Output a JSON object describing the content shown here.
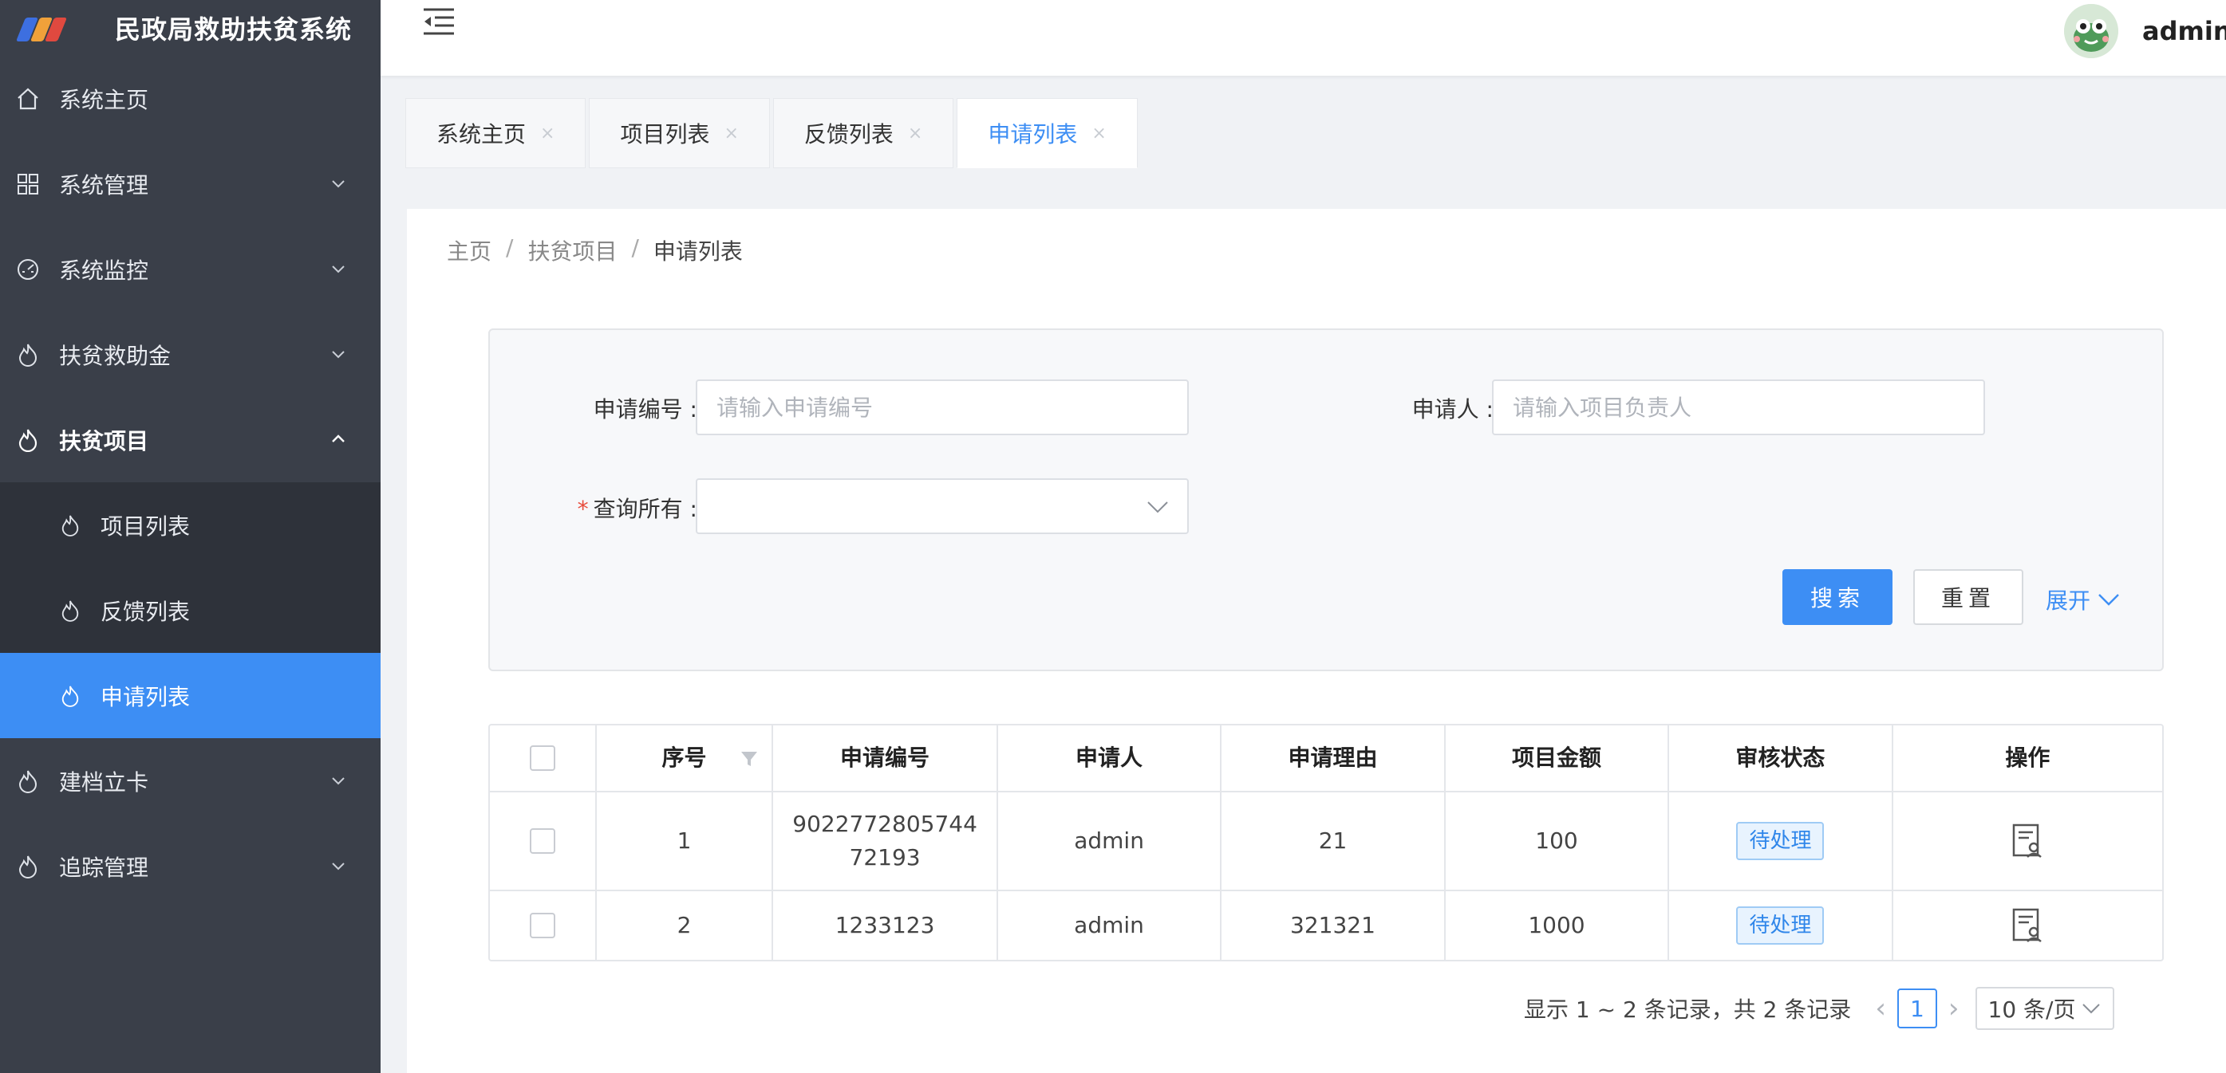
{
  "app": {
    "title": "民政局救助扶贫系统"
  },
  "sidebar": {
    "items": [
      {
        "label": "系统主页",
        "icon": "home-icon"
      },
      {
        "label": "系统管理",
        "icon": "grid-icon"
      },
      {
        "label": "系统监控",
        "icon": "dashboard-icon"
      },
      {
        "label": "扶贫救助金",
        "icon": "fire-icon"
      },
      {
        "label": "扶贫项目",
        "icon": "fire-icon"
      },
      {
        "label": "建档立卡",
        "icon": "fire-icon"
      },
      {
        "label": "追踪管理",
        "icon": "fire-icon"
      }
    ],
    "submenu": [
      {
        "label": "项目列表"
      },
      {
        "label": "反馈列表"
      },
      {
        "label": "申请列表"
      }
    ],
    "accent": "#3d8ef4",
    "background": "#3a3f49"
  },
  "header": {
    "username": "admin"
  },
  "tabs": [
    {
      "label": "系统主页"
    },
    {
      "label": "项目列表"
    },
    {
      "label": "反馈列表"
    },
    {
      "label": "申请列表"
    }
  ],
  "breadcrumb": [
    "主页",
    "扶贫项目",
    "申请列表"
  ],
  "search": {
    "apply_no_label": "申请编号",
    "apply_no_placeholder": "请输入申请编号",
    "applicant_label": "申请人",
    "applicant_placeholder": "请输入项目负责人",
    "query_all_label": "查询所有",
    "search_button": "搜索",
    "reset_button": "重置",
    "expand_link": "展开"
  },
  "table": {
    "headers": [
      "序号",
      "申请编号",
      "申请人",
      "申请理由",
      "项目金额",
      "审核状态",
      "操作"
    ],
    "rows": [
      {
        "no": "1",
        "id": "902277280574472193",
        "user": "admin",
        "reason": "21",
        "amount": "100",
        "status": "待处理"
      },
      {
        "no": "2",
        "id": "1233123",
        "user": "admin",
        "reason": "321321",
        "amount": "1000",
        "status": "待处理"
      }
    ]
  },
  "pagination": {
    "summary": "显示 1 ~ 2 条记录，共 2 条记录",
    "current_page": "1",
    "page_size": "10 条/页"
  }
}
